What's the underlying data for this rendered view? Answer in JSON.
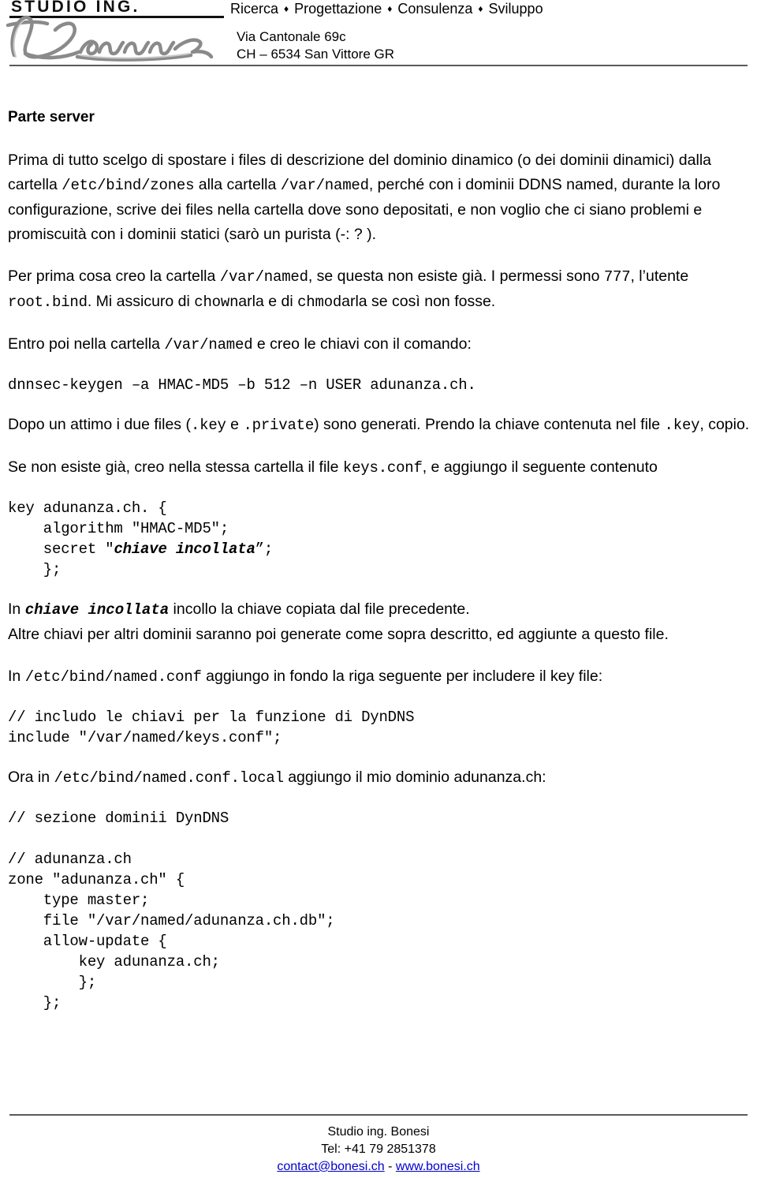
{
  "header": {
    "brand_word": "STUDIO ING.",
    "services": [
      "Ricerca",
      "Progettazione",
      "Consulenza",
      "Sviluppo"
    ],
    "service_separator": "♦",
    "signature_name": "Bonesi",
    "address_line1": "Via Cantonale 69c",
    "address_line2": "CH – 6534 San Vittore GR",
    "rule_color": "#595959"
  },
  "document": {
    "section_heading": "Parte server",
    "paragraph1": {
      "part1": "Prima di tutto scelgo di spostare i files di descrizione del dominio dinamico (o dei dominii dinamici) dalla cartella ",
      "code1": "/etc/bind/zones",
      "part2": " alla cartella ",
      "code2": "/var/named",
      "part3": ", perché con i dominii DDNS named, durante la loro configurazione, scrive dei files nella cartella dove sono depositati, e non voglio che ci siano problemi e promiscuità con i dominii statici (sarò un purista (-: ? )."
    },
    "paragraph2": {
      "part1": "Per prima cosa creo la cartella ",
      "code1": "/var/named",
      "part2": ", se questa non esiste già. I permessi sono ",
      "code2": "777",
      "part3": ", l’utente ",
      "code3": "root.bind",
      "part4": ". Mi assicuro di ",
      "code4": "chown",
      "part5": "arla e di ",
      "code5": "chmod",
      "part6": "arla se così non fosse."
    },
    "paragraph3": {
      "part1": "Entro poi nella cartella ",
      "code1": "/var/named",
      "part2": " e creo le chiavi con il comando:"
    },
    "command": "dnnsec-keygen –a HMAC-MD5 –b 512 –n USER adunanza.ch.",
    "paragraph4": {
      "part1": "Dopo un attimo i due files (",
      "code1": ".key",
      "part2": " e ",
      "code2": ".private",
      "part3": ") sono generati. Prendo la chiave contenuta nel file ",
      "code3": ".key",
      "part4": ", copio."
    },
    "paragraph5": {
      "part1": "Se non esiste già, creo nella stessa cartella il file ",
      "code1": "keys.conf",
      "part2": ", e aggiungo il seguente contenuto"
    },
    "keys_conf_block": {
      "line1": "key adunanza.ch. {",
      "line2": "    algorithm \"HMAC-MD5\";",
      "line3_prefix": "    secret \"",
      "line3_emph": "chiave incollata",
      "line3_suffix": "”;",
      "line4": "    };"
    },
    "paragraph6": {
      "part1": "In ",
      "code1": "chiave incollata",
      "part2": " incollo la chiave copiata dal file precedente."
    },
    "paragraph7": "Altre chiavi per altri dominii saranno poi generate come sopra descritto, ed aggiunte a questo file.",
    "paragraph8": {
      "part1": "In ",
      "code1": "/etc/bind/named.conf",
      "part2": " aggiungo in fondo la riga seguente per includere il key file:"
    },
    "named_conf_block": {
      "line1": "// includo le chiavi per la funzione di DynDNS",
      "line2": "include \"/var/named/keys.conf\";"
    },
    "paragraph9": {
      "part1": "Ora in ",
      "code1": "/etc/bind/named.conf.local",
      "part2": " aggiungo il mio dominio adunanza.ch:"
    },
    "zone_block": {
      "line1": "// sezione dominii DynDNS",
      "line2": "",
      "line3": "// adunanza.ch",
      "line4": "zone \"adunanza.ch\" {",
      "line5": "    type master;",
      "line6": "    file \"/var/named/adunanza.ch.db\";",
      "line7": "    allow-update {",
      "line8": "        key adunanza.ch;",
      "line9": "        };",
      "line10": "    };"
    }
  },
  "footer": {
    "company": "Studio ing. Bonesi",
    "phone": "Tel: +41 79 2851378",
    "email": "contact@bonesi.ch",
    "separator": " - ",
    "website": "www.bonesi.ch",
    "link_color": "#0000CC"
  }
}
